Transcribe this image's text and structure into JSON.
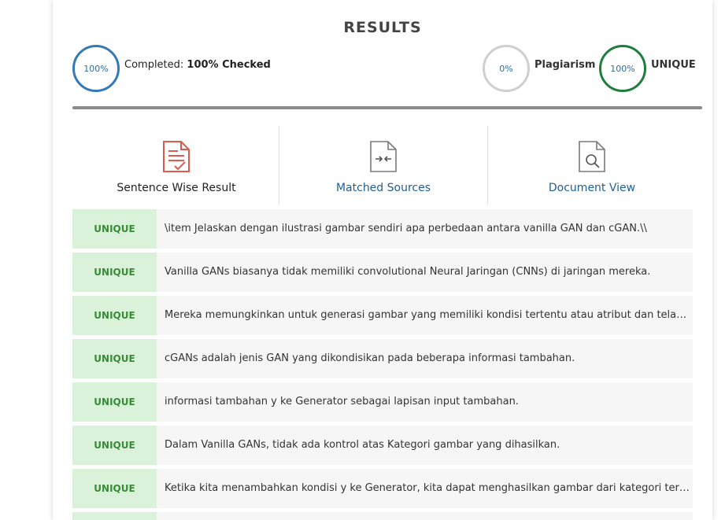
{
  "results": {
    "title": "RESULTS",
    "completed": {
      "ring_text": "100%",
      "label_prefix": "Completed: ",
      "label_bold": "100% Checked",
      "value_percent": 100
    },
    "plagiarism": {
      "ring_text": "0%",
      "label": "Plagiarism",
      "value_percent": 0
    },
    "unique": {
      "ring_text": "100%",
      "label": "UNIQUE",
      "value_percent": 100
    },
    "progress_percent": 100,
    "colors": {
      "completed": "#337ab7",
      "plagiarism": "#cfcfcf",
      "unique": "#1e7d3c",
      "badge_bg": "#d9f2d9",
      "badge_text": "#3a8a3a",
      "link": "#1f5f96",
      "icon_red": "#e05a4e"
    }
  },
  "tabs": [
    {
      "label": "Sentence Wise Result",
      "icon": "document-check-icon"
    },
    {
      "label": "Matched Sources",
      "icon": "document-compare-icon"
    },
    {
      "label": "Document View",
      "icon": "document-search-icon"
    }
  ],
  "rows": [
    {
      "status": "UNIQUE",
      "text": "\\item Jelaskan dengan ilustrasi gambar sendiri apa perbedaan antara vanilla GAN dan cGAN.\\\\"
    },
    {
      "status": "UNIQUE",
      "text": "Vanilla GANs biasanya tidak memiliki convolutional Neural Jaringan (CNNs) di jaringan mereka."
    },
    {
      "status": "UNIQUE",
      "text": "Mereka memungkinkan untuk generasi gambar yang memiliki kondisi tertentu atau atribut dan telah terbukti lebih baik daripada Vanilla GANs."
    },
    {
      "status": "UNIQUE",
      "text": "cGANs adalah jenis GAN yang dikondisikan pada beberapa informasi tambahan."
    },
    {
      "status": "UNIQUE",
      "text": "informasi tambahan y ke Generator sebagai lapisan input tambahan."
    },
    {
      "status": "UNIQUE",
      "text": "Dalam Vanilla GANs, tidak ada kontrol atas Kategori gambar yang dihasilkan."
    },
    {
      "status": "UNIQUE",
      "text": "Ketika kita menambahkan kondisi y ke Generator, kita dapat menghasilkan gambar dari kategori tertentu."
    },
    {
      "status": "UNIQUE",
      "text": ""
    }
  ]
}
